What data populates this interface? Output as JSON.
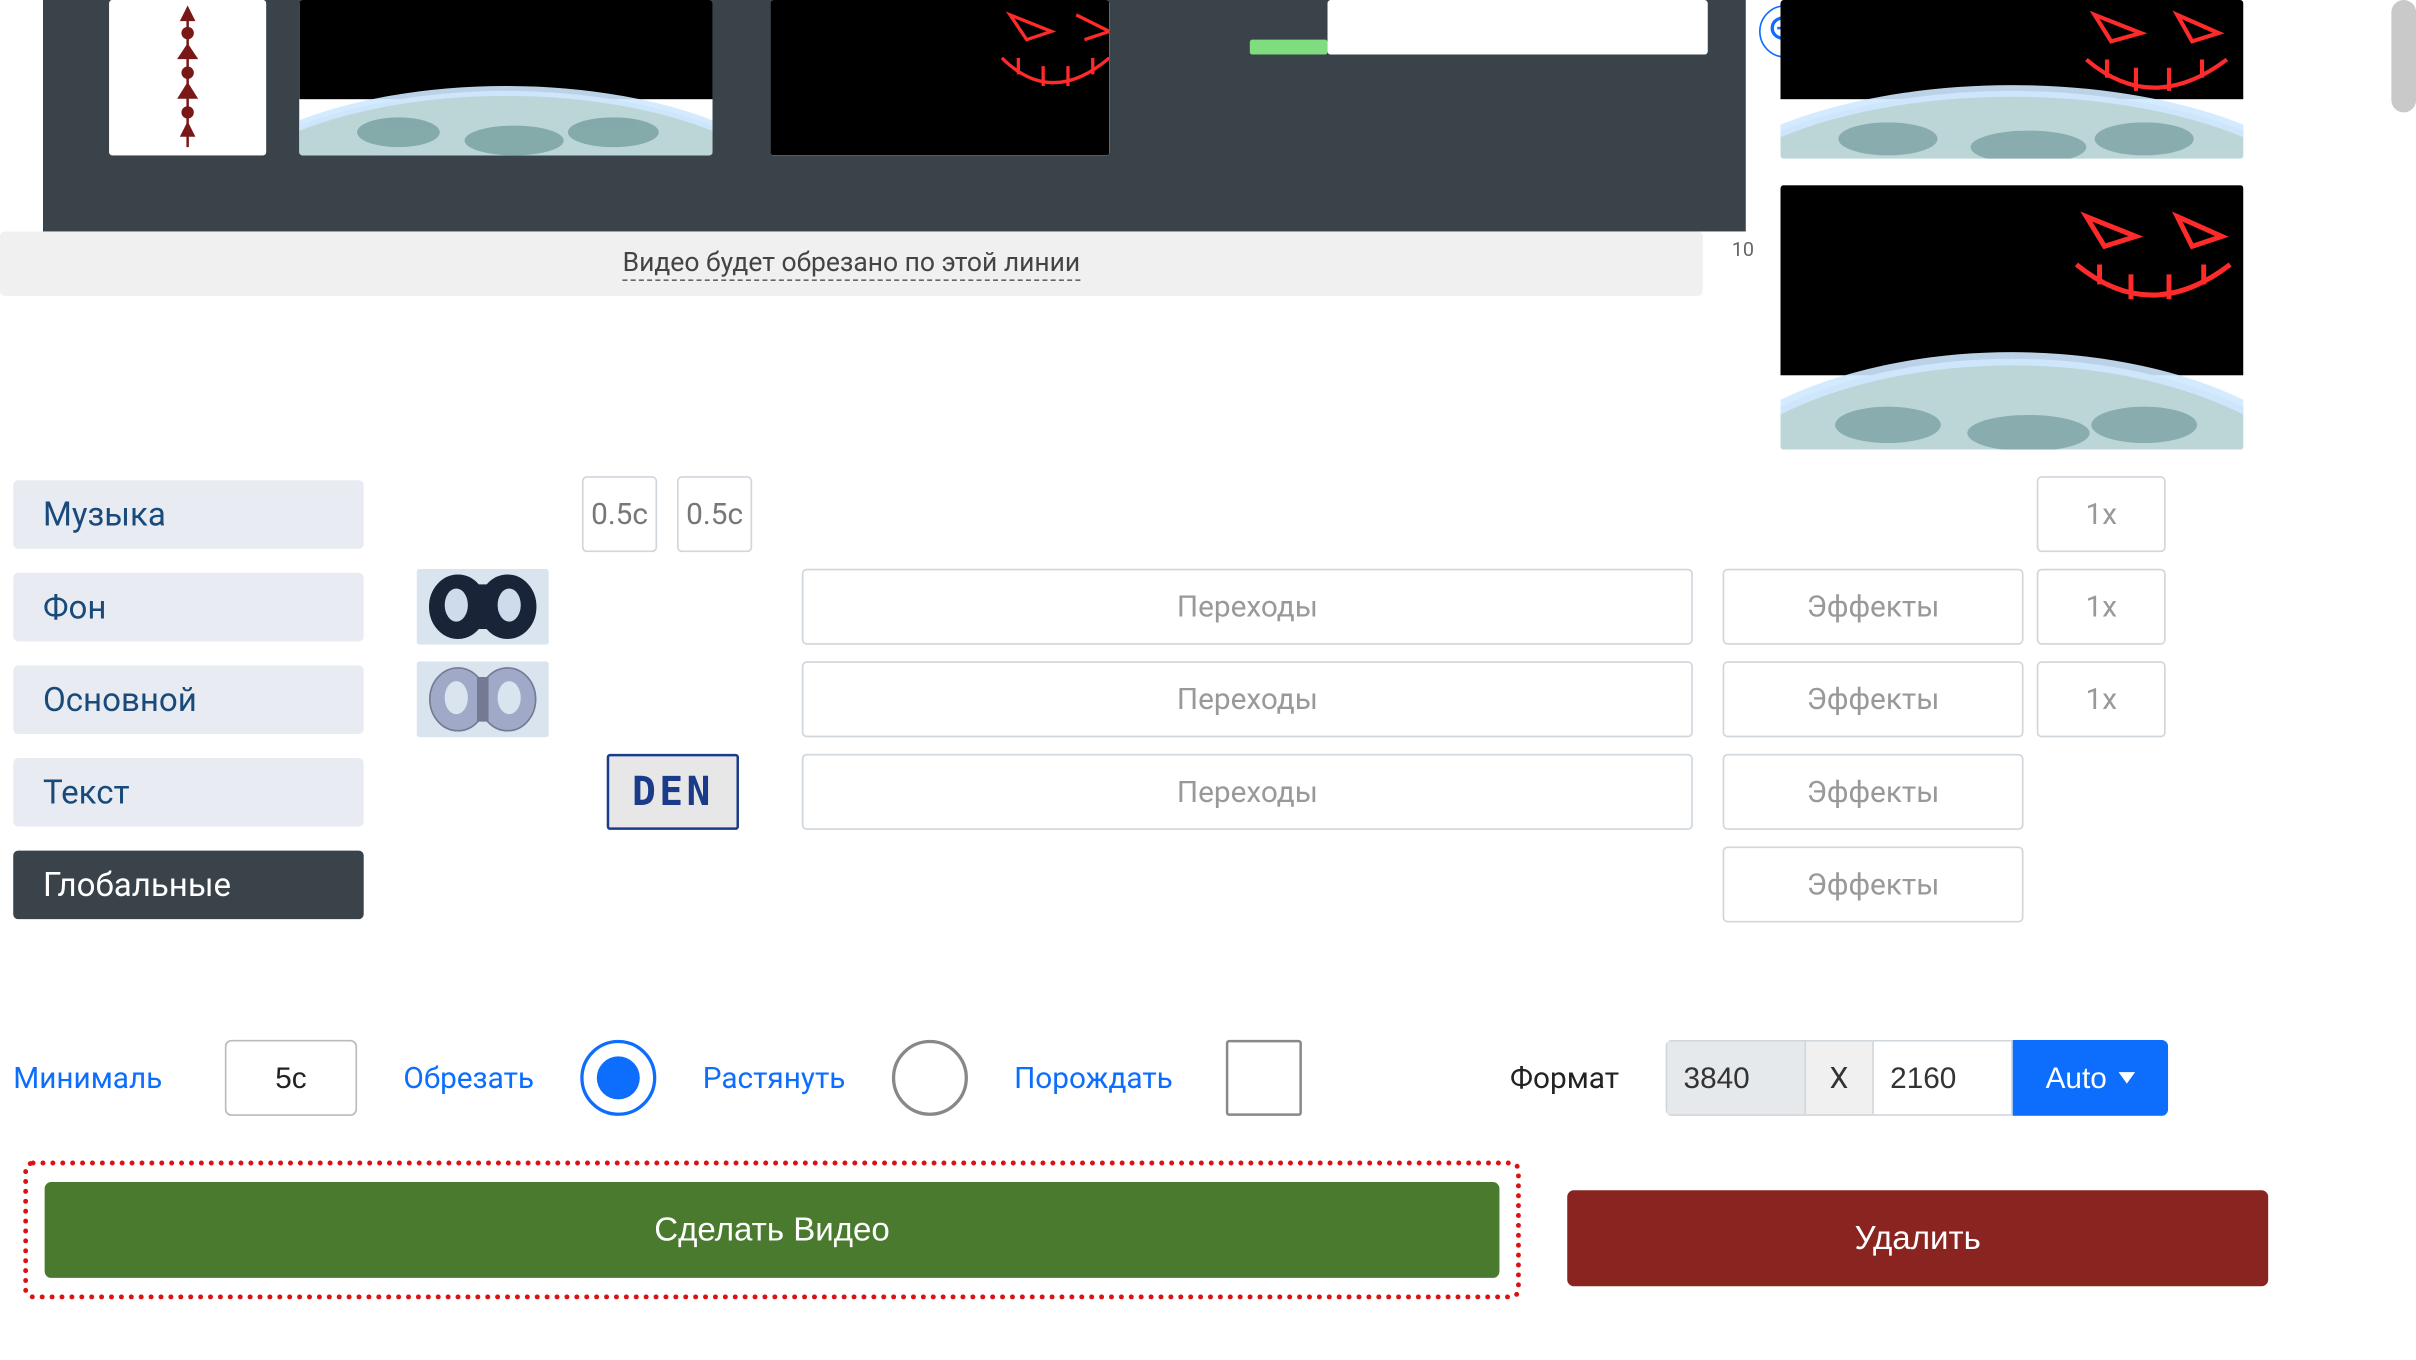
{
  "timeline": {
    "crop_message": "Видео будет обрезано по этой линии",
    "tick": "10"
  },
  "layers": {
    "music": {
      "label": "Музыка",
      "sec_a": "0.5с",
      "sec_b": "0.5с",
      "mult": "1x"
    },
    "bg": {
      "label": "Фон",
      "transitions": "Переходы",
      "effects": "Эффекты",
      "mult": "1x"
    },
    "main": {
      "label": "Основной",
      "transitions": "Переходы",
      "effects": "Эффекты",
      "mult": "1x"
    },
    "text": {
      "label": "Текст",
      "demo": "DEN",
      "transitions": "Переходы",
      "effects": "Эффекты"
    },
    "global": {
      "label": "Глобальные",
      "effects": "Эффекты"
    }
  },
  "options": {
    "min_label": "Минималь",
    "min_value": "5с",
    "crop_label": "Обрезать",
    "stretch_label": "Растянуть",
    "spawn_label": "Порождать",
    "format_label": "Формат",
    "width": "3840",
    "x": "X",
    "height": "2160",
    "auto": "Auto"
  },
  "actions": {
    "make": "Сделать Видео",
    "delete": "Удалить"
  }
}
